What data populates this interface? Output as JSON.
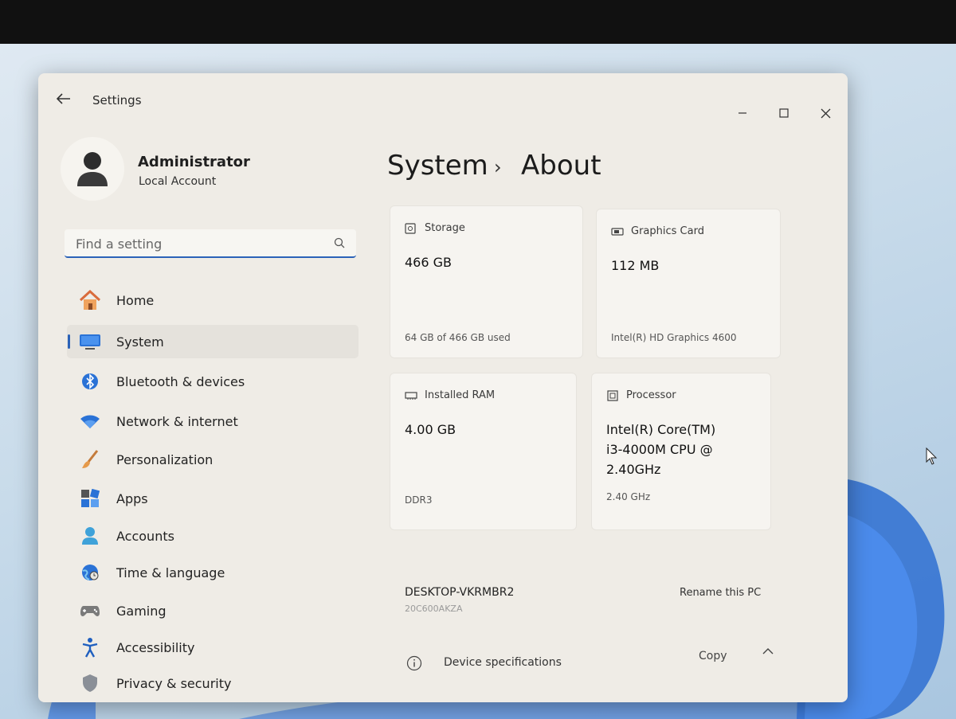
{
  "window": {
    "title": "Settings"
  },
  "profile": {
    "name": "Administrator",
    "account_type": "Local Account"
  },
  "search": {
    "placeholder": "Find a setting"
  },
  "sidebar": {
    "items": [
      {
        "label": "Home",
        "icon": "home-icon",
        "active": false
      },
      {
        "label": "System",
        "icon": "monitor-icon",
        "active": true
      },
      {
        "label": "Bluetooth & devices",
        "icon": "bluetooth-icon",
        "active": false
      },
      {
        "label": "Network & internet",
        "icon": "wifi-icon",
        "active": false
      },
      {
        "label": "Personalization",
        "icon": "brush-icon",
        "active": false
      },
      {
        "label": "Apps",
        "icon": "apps-icon",
        "active": false
      },
      {
        "label": "Accounts",
        "icon": "account-icon",
        "active": false
      },
      {
        "label": "Time & language",
        "icon": "globe-clock-icon",
        "active": false
      },
      {
        "label": "Gaming",
        "icon": "gamepad-icon",
        "active": false
      },
      {
        "label": "Accessibility",
        "icon": "accessibility-icon",
        "active": false
      },
      {
        "label": "Privacy & security",
        "icon": "shield-icon",
        "active": false
      }
    ]
  },
  "breadcrumb": {
    "parent": "System",
    "separator": "›",
    "current": "About"
  },
  "specs": {
    "storage": {
      "label": "Storage",
      "value": "466 GB",
      "detail": "64 GB of 466 GB used"
    },
    "graphics": {
      "label": "Graphics Card",
      "value": "112 MB",
      "detail": "Intel(R) HD Graphics 4600"
    },
    "ram": {
      "label": "Installed RAM",
      "value": "4.00 GB",
      "detail": "DDR3"
    },
    "processor": {
      "label": "Processor",
      "value_lines": [
        "Intel(R) Core(TM)",
        "i3-4000M CPU @",
        "2.40GHz"
      ],
      "detail": "2.40 GHz"
    }
  },
  "device": {
    "name": "DESKTOP-VKRMBR2",
    "model": "20C600AKZA",
    "rename_label": "Rename this PC"
  },
  "device_specs": {
    "label": "Device specifications",
    "copy_label": "Copy"
  },
  "colors": {
    "accent": "#2b62b8",
    "window_bg": "#efece6"
  }
}
